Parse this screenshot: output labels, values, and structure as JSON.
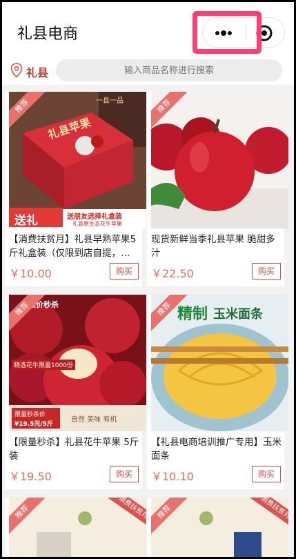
{
  "header": {
    "title": "礼县电商"
  },
  "location": {
    "label": "礼县"
  },
  "search": {
    "placeholder": "输入商品名称进行搜索"
  },
  "badges": {
    "recommend": "推荐"
  },
  "buy_label": "购买",
  "products": [
    {
      "title": "【消费扶贫月】礼县早熟苹果5斤礼盒装（仅限到店自提，…",
      "price": "￥10.00",
      "image_text": {
        "top": "一县一品",
        "box": "礼县苹果",
        "banner_left": "送礼",
        "banner_right": "送朋友选择礼盒装",
        "banner_sub": "礼县原生态花牛苹果"
      }
    },
    {
      "title": "现货新鲜当季礼县苹果 脆甜多汁",
      "price": "￥22.50"
    },
    {
      "title": "【限量秒杀】礼县花牛苹果 5斤装",
      "price": "￥19.50",
      "image_text": {
        "top": "限价秒杀",
        "mid": "精选花牛限量1000份",
        "bottom_left": "限量秒杀价",
        "bottom_price": "¥19.5元/5斤",
        "bottom_right": "自然 美味 有机"
      }
    },
    {
      "title": "【礼县电商培训推广专用】玉米面条",
      "price": "￥10.10",
      "image_text": {
        "top_a": "精制",
        "top_b": "玉米面条"
      }
    },
    {
      "title": "",
      "price": "",
      "image_text": {
        "ribbon": "消费扶贫月"
      }
    },
    {
      "title": "",
      "price": "",
      "image_text": {
        "ribbon": "消费扶贫月"
      }
    }
  ]
}
